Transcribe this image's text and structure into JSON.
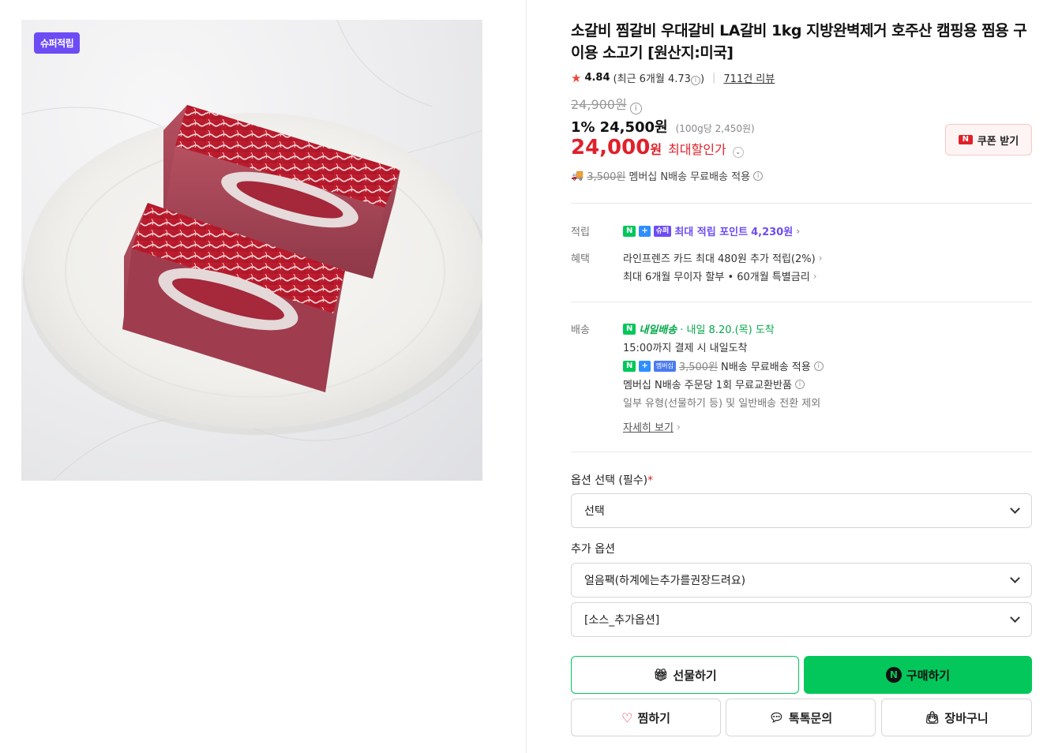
{
  "image": {
    "badge": "슈퍼적립",
    "alt_icon": "short-rib-photo"
  },
  "product": {
    "title": "소갈비 찜갈비 우대갈비 LA갈비 1kg 지방완벽제거 호주산 캠핑용 찜용 구이용 소고기 [원산지:미국]",
    "rating": "4.84",
    "recent_rating": "(최근 6개월 4.73",
    "recent_close": ")",
    "review_count": "711건 리뷰",
    "original_price": "24,900원",
    "discount_pct": "1%",
    "sale_price": "24,500원",
    "unit_price": "(100g당 2,450원)",
    "max_price": "24,000",
    "max_price_unit": "원",
    "max_label": "최대할인가",
    "coupon_button": "쿠폰 받기",
    "shipping_strike": "3,500원",
    "shipping_text": "멤버십 N배송 무료배송 적용"
  },
  "benefits": {
    "points_label": "적립",
    "points_text": "최대 적립 포인트",
    "points_value": "4,230원",
    "benefit_label": "혜택",
    "benefit_line1": "라인프렌즈 카드 최대 480원 추가 적립(2%)",
    "benefit_line2": "최대 6개월 무이자 할부 • 60개월 특별금리"
  },
  "delivery": {
    "label": "배송",
    "brand": "내일배송",
    "arrival": "· 내일 8.20.(목) 도착",
    "cutoff": "15:00까지 결제 시 내일도착",
    "member_tag": "멤버십",
    "member_strike": "3,500원",
    "member_text": "N배송 무료배송 적용",
    "exchange": "멤버십 N배송 주문당 1회 무료교환반품",
    "exclude": "일부 유형(선물하기 등) 및 일반배송 전환 제외",
    "detail_link": "자세히 보기"
  },
  "options": {
    "required_label": "옵션 선택 (필수)",
    "required_mark": "*",
    "select_value": "선택",
    "extra_label": "추가 옵션",
    "extra1": "얼음팩(하계에는추가를권장드려요)",
    "extra2": "[소스_추가옵션]"
  },
  "actions": {
    "gift": "선물하기",
    "buy": "구매하기",
    "wish": "찜하기",
    "talk": "톡톡문의",
    "cart": "장바구니"
  },
  "colors": {
    "naver_green": "#03c75a",
    "price_red": "#e0202a",
    "super_purple": "#6d4cf5"
  }
}
